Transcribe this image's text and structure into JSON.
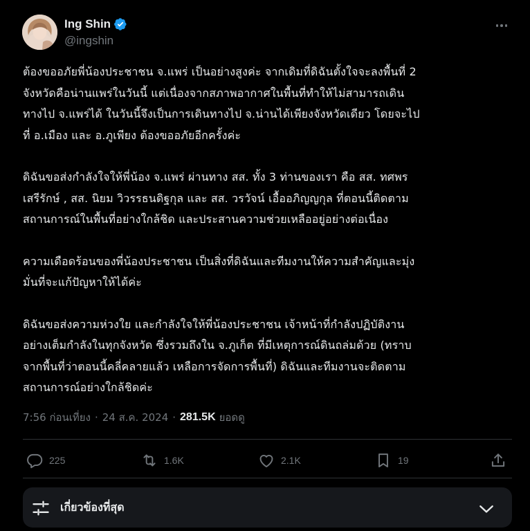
{
  "author": {
    "display_name": "Ing Shin",
    "handle": "@ingshin",
    "verified": true
  },
  "post": {
    "paragraphs": [
      "ต้องขออภัยพี่น้องประชาชน จ.แพร่ เป็นอย่างสูงค่ะ จากเดิมที่ดิฉันตั้งใจจะลงพื้นที่ 2\nจังหวัดคือน่านแพร่ในวันนี้ แต่เนื่องจากสภาพอากาศในพื้นที่ทำให้ไม่สามารถเดิน\nทางไป จ.แพร่ได้ ในวันนี้จึงเป็นการเดินทางไป จ.น่านได้เพียงจังหวัดเดียว โดยจะไป\nที่ อ.เมือง และ อ.ภูเพียง ต้องขออภัยอีกครั้งค่ะ",
      "ดิฉันขอส่งกำลังใจให้พี่น้อง จ.แพร่ ผ่านทาง สส. ทั้ง 3 ท่านของเรา คือ สส. ทศพร\nเสรีรักษ์ , สส. นิยม วิวรรธนดิฐกุล และ สส. วรวัจน์ เอื้ออภิญญกุล ที่ตอนนี้ติดตาม\nสถานการณ์ในพื้นที่อย่างใกล้ชิด และประสานความช่วยเหลืออยู่อย่างต่อเนื่อง",
      "ความเดือดร้อนของพี่น้องประชาชน เป็นสิ่งที่ดิฉันและทีมงานให้ความสำคัญและมุ่ง\nมั่นที่จะแก้ปัญหาให้ได้ค่ะ",
      "ดิฉันขอส่งความห่วงใย และกำลังใจให้พี่น้องประชาชน เจ้าหน้าที่กำลังปฏิบัติงาน\nอย่างเต็มกำลังในทุกจังหวัด ซึ่งรวมถึงใน จ.ภูเก็ต ที่มีเหตุการณ์ดินถล่มด้วย (ทราบ\nจากพื้นที่ว่าตอนนี้คลี่คลายแล้ว เหลือการจัดการพื้นที่) ดิฉันและทีมงานจะติดตาม\nสถานการณ์อย่างใกล้ชิดค่ะ"
    ],
    "time": "7:56 ก่อนเที่ยง",
    "separator": "·",
    "date": "24 ส.ค. 2024",
    "views_count": "281.5K",
    "views_label": "ยอดดู"
  },
  "actions": {
    "replies": "225",
    "reposts": "1.6K",
    "likes": "2.1K",
    "bookmarks": "19"
  },
  "related": {
    "label": "เกี่ยวข้องที่สุด"
  },
  "colors": {
    "background": "#000000",
    "text_primary": "#e7e9ea",
    "text_secondary": "#71767b",
    "verified_blue": "#1d9bf0",
    "divider": "#2f3336",
    "panel": "#16181c"
  }
}
